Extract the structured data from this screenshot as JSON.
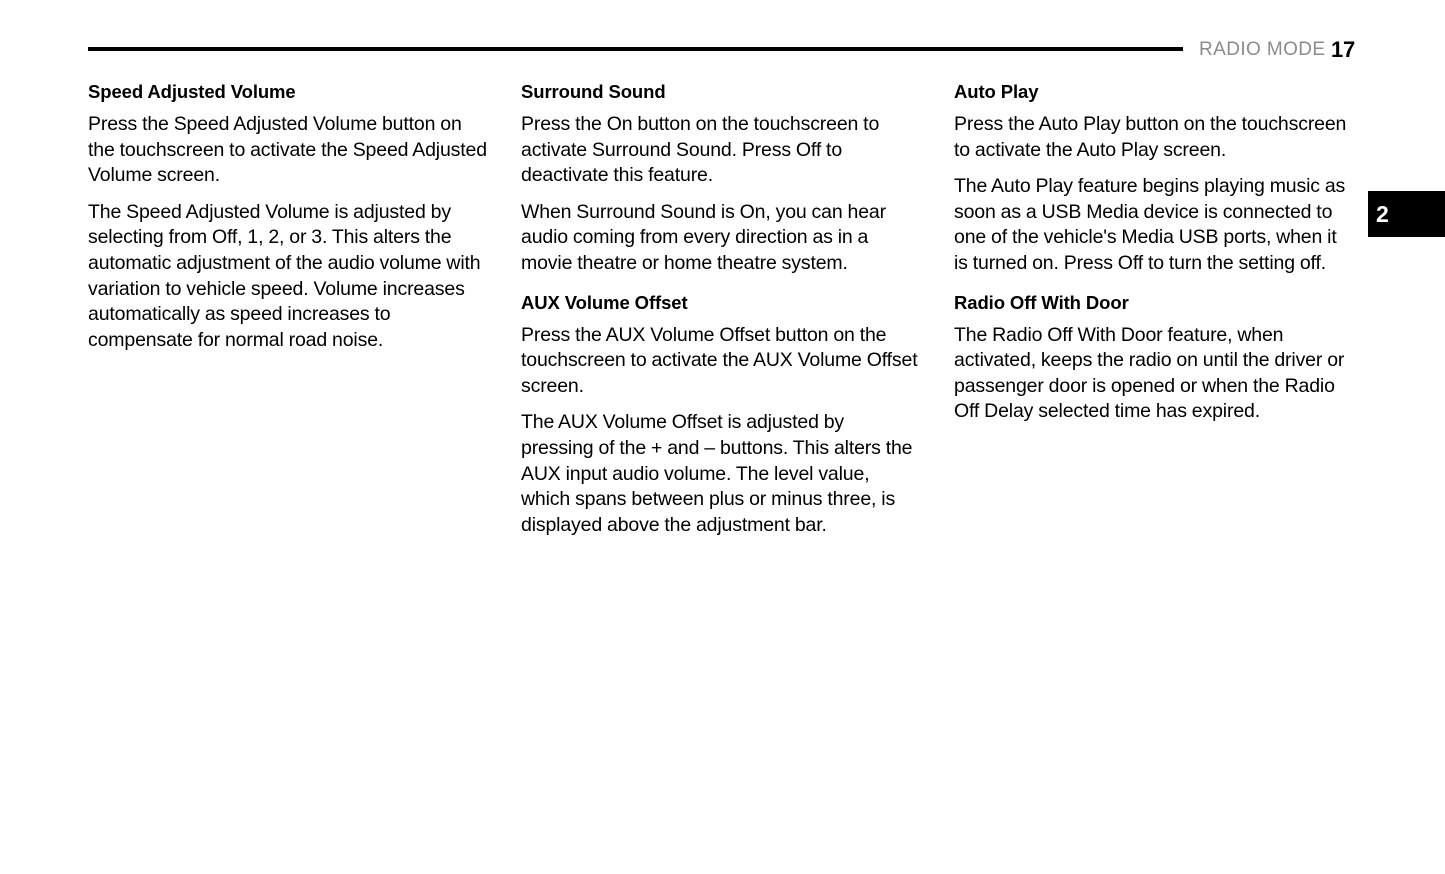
{
  "header": {
    "section_label": "RADIO MODE",
    "page_number": "17"
  },
  "chapter_tab": {
    "label": "2"
  },
  "columns": [
    {
      "sections": [
        {
          "heading": "Speed Adjusted Volume",
          "paragraphs": [
            "Press the Speed Adjusted Volume button on the touchscreen to activate the Speed Adjusted Volume screen.",
            "The Speed Adjusted Volume is adjusted by selecting from Off, 1, 2, or 3. This alters the automatic adjustment of the audio volume with variation to vehicle speed. Volume increases automatically as speed increases to compensate for normal road noise."
          ]
        }
      ]
    },
    {
      "sections": [
        {
          "heading": "Surround Sound",
          "paragraphs": [
            "Press the On button on the touchscreen to activate Surround Sound. Press Off to deactivate this feature.",
            "When Surround Sound is On, you can hear audio coming from every direction as in a movie theatre or home theatre system."
          ]
        },
        {
          "heading": "AUX Volume Offset",
          "paragraphs": [
            "Press the AUX Volume Offset button on the touchscreen to activate the AUX Volume Offset screen.",
            "The AUX Volume Offset is adjusted by pressing of the + and – buttons. This alters the AUX input audio volume. The level value, which spans between plus or minus three, is displayed above the adjustment bar."
          ]
        }
      ]
    },
    {
      "sections": [
        {
          "heading": "Auto Play",
          "paragraphs": [
            "Press the Auto Play button on the touchscreen to activate the Auto Play screen.",
            "The Auto Play feature begins playing music as soon as a USB Media device is connected to one of the vehicle's Media USB ports, when it is turned on. Press Off to turn the setting off."
          ]
        },
        {
          "heading": "Radio Off With Door",
          "paragraphs": [
            "The Radio Off With Door feature, when activated, keeps the radio on until the driver or passenger door is opened or when the Radio Off Delay selected time has expired."
          ]
        }
      ]
    }
  ]
}
